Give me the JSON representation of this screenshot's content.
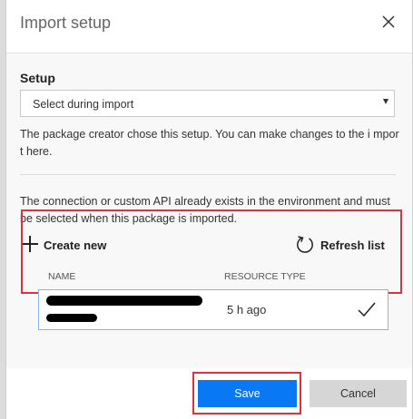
{
  "dialog": {
    "title": "Import setup",
    "close_icon": "close-icon"
  },
  "setup": {
    "label": "Setup",
    "selected": "Select during import",
    "description": "The package creator chose this setup. You can make changes to the i mport here."
  },
  "connection": {
    "description": "The connection or custom API already exists in the environment and must be selected when this package is imported.",
    "create_new_label": "Create new",
    "refresh_label": "Refresh list"
  },
  "table": {
    "columns": [
      "NAME",
      "RESOURCE TYPE"
    ],
    "rows": [
      {
        "name_redacted": true,
        "time": "5 h ago",
        "selected": true
      }
    ]
  },
  "footer": {
    "save_label": "Save",
    "cancel_label": "Cancel"
  },
  "colors": {
    "accent": "#0b78f3",
    "highlight": "#d9343b"
  }
}
